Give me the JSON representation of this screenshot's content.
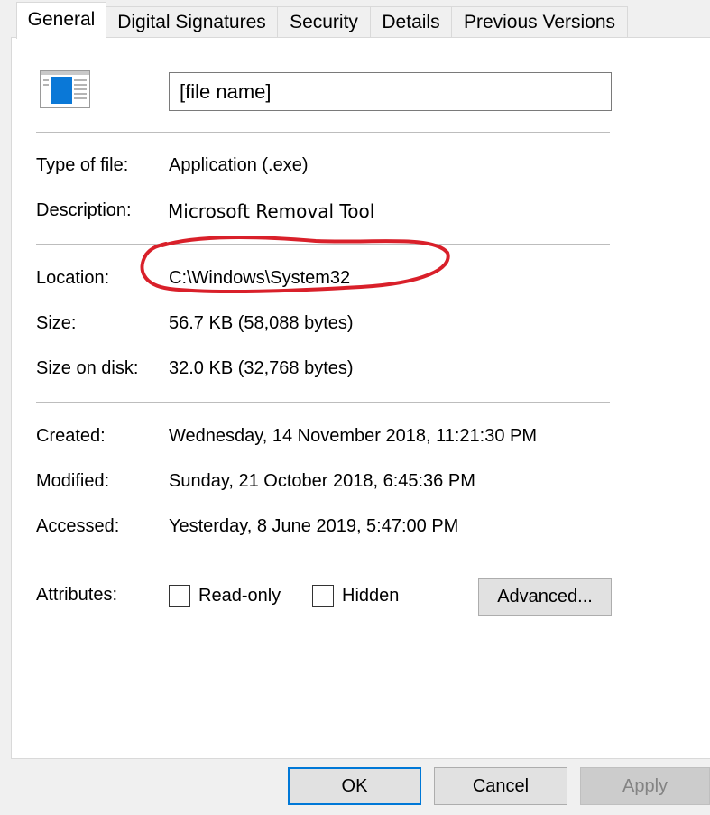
{
  "tabs": [
    "General",
    "Digital Signatures",
    "Security",
    "Details",
    "Previous Versions"
  ],
  "active_tab": "General",
  "file": {
    "name_value": "[file name]",
    "icon": "application-window-icon"
  },
  "properties": {
    "type": {
      "label": "Type of file:",
      "value": "Application (.exe)"
    },
    "description": {
      "label": "Description:",
      "value": "Microsoft Removal Tool"
    },
    "location": {
      "label": "Location:",
      "value": "C:\\Windows\\System32"
    },
    "size": {
      "label": "Size:",
      "value": "56.7 KB (58,088 bytes)"
    },
    "size_on_disk": {
      "label": "Size on disk:",
      "value": "32.0 KB (32,768 bytes)"
    },
    "created": {
      "label": "Created:",
      "value": "Wednesday, 14 November 2018, 11:21:30 PM"
    },
    "modified": {
      "label": "Modified:",
      "value": "Sunday, 21 October 2018, 6:45:36 PM"
    },
    "accessed": {
      "label": "Accessed:",
      "value": "Yesterday, 8 June 2019, 5:47:00 PM"
    }
  },
  "attributes": {
    "label": "Attributes:",
    "read_only": {
      "label": "Read-only",
      "checked": false
    },
    "hidden": {
      "label": "Hidden",
      "checked": false
    },
    "advanced_label": "Advanced..."
  },
  "buttons": {
    "ok": "OK",
    "cancel": "Cancel",
    "apply": "Apply"
  },
  "colors": {
    "annotation": "#d9202a",
    "default_button_border": "#0078d7",
    "icon_blue": "#0a78d7"
  }
}
